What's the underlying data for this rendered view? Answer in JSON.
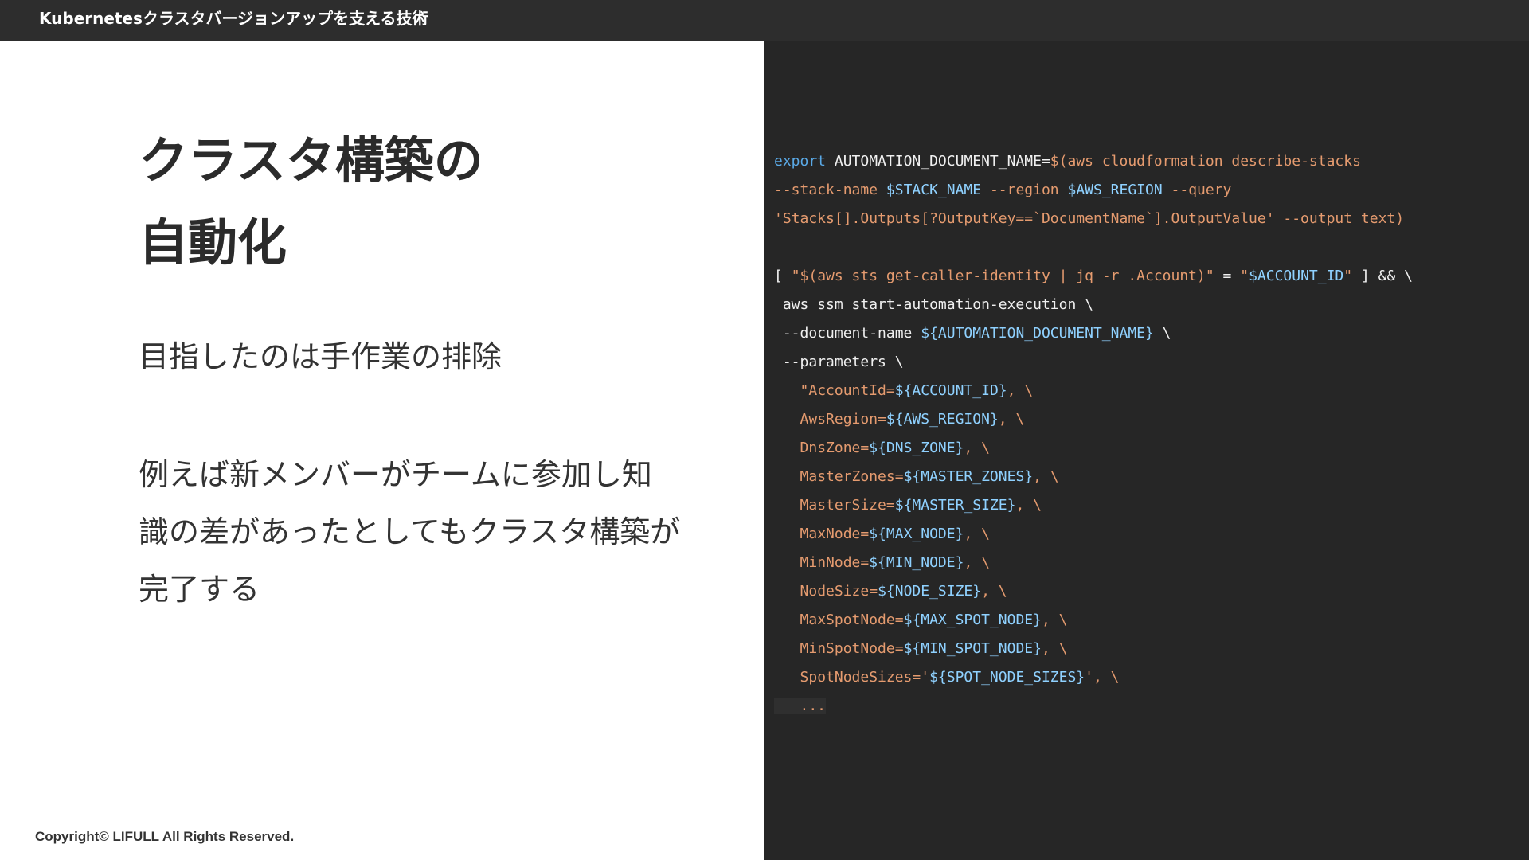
{
  "header": {
    "title": "Kubernetesクラスタバージョンアップを支える技術"
  },
  "slide": {
    "title_lines": [
      "クラスタ構築の",
      "自動化"
    ],
    "subtitle": "目指したのは手作業の排除",
    "body_lines": [
      "例えば新メンバーがチームに参加し知",
      "識の差があったとしてもクラスタ構築が",
      "完了する"
    ]
  },
  "footer": {
    "copyright": "Copyright© LIFULL All Rights Reserved."
  },
  "code": {
    "lines": [
      [
        [
          "kw",
          "export"
        ],
        [
          "plain",
          " AUTOMATION_DOCUMENT_NAME="
        ],
        [
          "str",
          "$(aws cloudformation describe-stacks"
        ]
      ],
      [
        [
          "str",
          "--stack-name "
        ],
        [
          "var",
          "$STACK_NAME"
        ],
        [
          "str",
          " --region "
        ],
        [
          "var",
          "$AWS_REGION"
        ],
        [
          "str",
          " --query"
        ]
      ],
      [
        [
          "str",
          "'Stacks[].Outputs[?OutputKey==`DocumentName`].OutputValue' --output text)"
        ]
      ],
      [],
      [
        [
          "plain",
          "[ "
        ],
        [
          "str",
          "\"$(aws sts get-caller-identity | jq -r .Account)\""
        ],
        [
          "plain",
          " = "
        ],
        [
          "str",
          "\""
        ],
        [
          "var",
          "$ACCOUNT_ID"
        ],
        [
          "str",
          "\""
        ],
        [
          "plain",
          " ] && \\"
        ]
      ],
      [
        [
          "plain",
          " aws ssm start-automation-execution \\"
        ]
      ],
      [
        [
          "plain",
          " --document-name "
        ],
        [
          "var",
          "${AUTOMATION_DOCUMENT_NAME}"
        ],
        [
          "plain",
          " \\"
        ]
      ],
      [
        [
          "plain",
          " --parameters \\"
        ]
      ],
      [
        [
          "plain",
          "   "
        ],
        [
          "str",
          "\"AccountId="
        ],
        [
          "var",
          "${ACCOUNT_ID}"
        ],
        [
          "str",
          ", \\"
        ]
      ],
      [
        [
          "plain",
          "   "
        ],
        [
          "str",
          "AwsRegion="
        ],
        [
          "var",
          "${AWS_REGION}"
        ],
        [
          "str",
          ", \\"
        ]
      ],
      [
        [
          "plain",
          "   "
        ],
        [
          "str",
          "DnsZone="
        ],
        [
          "var",
          "${DNS_ZONE}"
        ],
        [
          "str",
          ", \\"
        ]
      ],
      [
        [
          "plain",
          "   "
        ],
        [
          "str",
          "MasterZones="
        ],
        [
          "var",
          "${MASTER_ZONES}"
        ],
        [
          "str",
          ", \\"
        ]
      ],
      [
        [
          "plain",
          "   "
        ],
        [
          "str",
          "MasterSize="
        ],
        [
          "var",
          "${MASTER_SIZE}"
        ],
        [
          "str",
          ", \\"
        ]
      ],
      [
        [
          "plain",
          "   "
        ],
        [
          "str",
          "MaxNode="
        ],
        [
          "var",
          "${MAX_NODE}"
        ],
        [
          "str",
          ", \\"
        ]
      ],
      [
        [
          "plain",
          "   "
        ],
        [
          "str",
          "MinNode="
        ],
        [
          "var",
          "${MIN_NODE}"
        ],
        [
          "str",
          ", \\"
        ]
      ],
      [
        [
          "plain",
          "   "
        ],
        [
          "str",
          "NodeSize="
        ],
        [
          "var",
          "${NODE_SIZE}"
        ],
        [
          "str",
          ", \\"
        ]
      ],
      [
        [
          "plain",
          "   "
        ],
        [
          "str",
          "MaxSpotNode="
        ],
        [
          "var",
          "${MAX_SPOT_NODE}"
        ],
        [
          "str",
          ", \\"
        ]
      ],
      [
        [
          "plain",
          "   "
        ],
        [
          "str",
          "MinSpotNode="
        ],
        [
          "var",
          "${MIN_SPOT_NODE}"
        ],
        [
          "str",
          ", \\"
        ]
      ],
      [
        [
          "plain",
          "   "
        ],
        [
          "str",
          "SpotNodeSizes='"
        ],
        [
          "var",
          "${SPOT_NODE_SIZES}"
        ],
        [
          "str",
          "', \\"
        ]
      ],
      [
        [
          "dots",
          "   ..."
        ]
      ]
    ]
  },
  "colors": {
    "topbar": "#2d2d2d",
    "code_bg": "#262626",
    "keyword": "#5aa9e6",
    "string": "#e59b6f",
    "variable": "#8fd1ff"
  }
}
